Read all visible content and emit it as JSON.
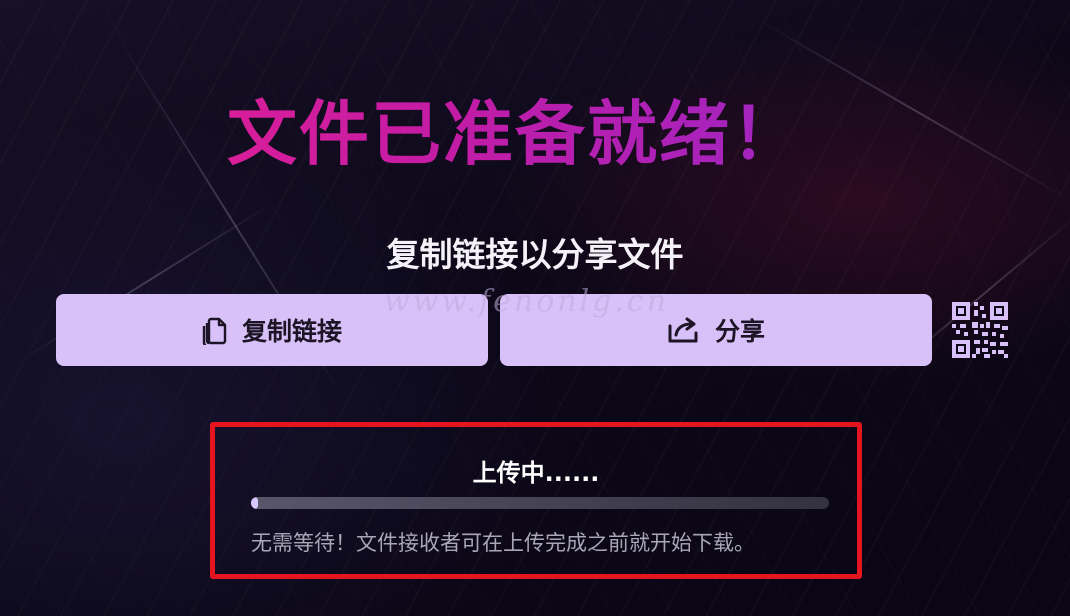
{
  "page": {
    "title": "文件已准备就绪！",
    "subtitle": "复制链接以分享文件"
  },
  "actions": {
    "copy_label": "复制链接",
    "copy_icon": "copy-icon",
    "share_label": "分享",
    "share_icon": "share-icon",
    "qr_icon": "qr-code-icon"
  },
  "watermark": "www.fenonlg.cn",
  "upload": {
    "status_text": "上传中......",
    "progress_fraction": 0.01,
    "note": "无需等待！文件接收者可在上传完成之前就开始下载。"
  },
  "colors": {
    "title_gradient": [
      "#ef1f8d",
      "#c11ca6",
      "#8a2bd6"
    ],
    "button_bg": "#d7c1f8",
    "highlight_border": "#e5151f",
    "progress_fill": "#d9c8ff"
  }
}
